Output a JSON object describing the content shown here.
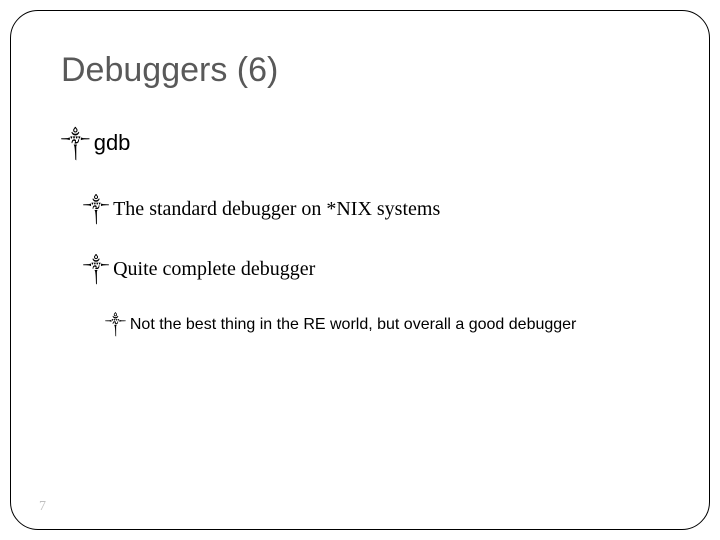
{
  "title": "Debuggers (6)",
  "bullets": {
    "l1": "gdb",
    "l2a": "The standard debugger on *NIX systems",
    "l2b": "Quite complete debugger",
    "l3": "Not the best thing in the RE world, but overall a good debugger"
  },
  "icons": {
    "curl": "༒"
  },
  "page": "7"
}
